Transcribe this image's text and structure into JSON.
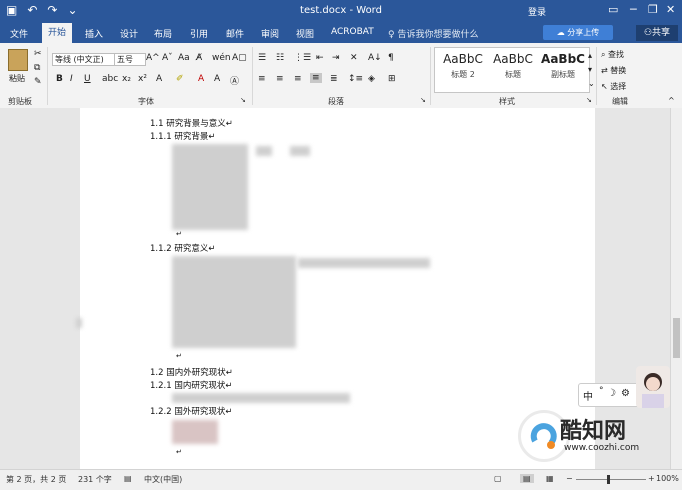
{
  "titlebar": {
    "title": "test.docx - Word",
    "login": "登录",
    "min": "─",
    "restore": "❐",
    "close": "✕"
  },
  "tabs": [
    "文件",
    "开始",
    "插入",
    "设计",
    "布局",
    "引用",
    "邮件",
    "审阅",
    "视图",
    "ACROBAT"
  ],
  "tellme": "告诉我你想要做什么",
  "share_upload": "分享上传",
  "share": "共享",
  "ribbon": {
    "paste": "粘贴",
    "font_name": "等线 (中文正)",
    "font_size": "五号",
    "clipboard_label": "剪贴板",
    "font_label": "字体",
    "paragraph_label": "段落",
    "styles_label": "样式",
    "editing_label": "编辑",
    "find": "查找",
    "replace": "替换",
    "select": "选择",
    "styles": [
      {
        "sample": "AaBbC",
        "name": "标题 2"
      },
      {
        "sample": "AaBbC",
        "name": "标题"
      },
      {
        "sample": "AaBbC",
        "name": "副标题"
      }
    ]
  },
  "document": {
    "lines": [
      "1.1 研究背景与意义↵",
      "1.1.1 研究背景↵",
      "1.1.2 研究意义↵",
      "1.2 国内外研究现状↵",
      "1.2.1 国内研究现状↵",
      "1.2.2 国外研究现状↵"
    ]
  },
  "ime": {
    "label": "中",
    "punct": "°"
  },
  "status": {
    "page": "第 2 页，共 2 页",
    "words": "231 个字",
    "lang": "中文(中国)",
    "zoom": "100%"
  },
  "watermark": {
    "brand": "酷知网",
    "url": "www.coozhi.com"
  }
}
